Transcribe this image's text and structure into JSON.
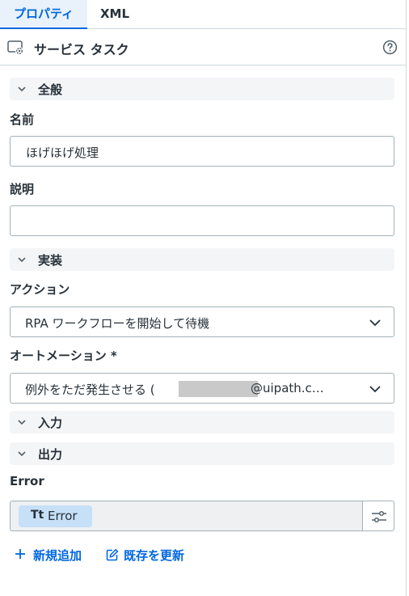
{
  "tabs": [
    {
      "label": "プロパティ",
      "active": true
    },
    {
      "label": "XML",
      "active": false
    }
  ],
  "header": {
    "task_icon": "service-task-icon",
    "title": "サービス タスク",
    "help_icon": "help-circle-icon"
  },
  "sections": {
    "general": "全般",
    "implementation": "実装",
    "input": "入力",
    "output": "出力"
  },
  "fields": {
    "name_label": "名前",
    "name_value": "ほげほげ処理",
    "description_label": "説明",
    "description_value": "",
    "action_label": "アクション",
    "action_value": "RPA ワークフローを開始して待機",
    "automation_label": "オートメーション *",
    "automation_value_prefix": "例外をただ発生させる (",
    "automation_value_suffix": "@uipath.c…",
    "error_label": "Error",
    "error_chip_type": "Tt",
    "error_chip_text": "Error"
  },
  "actions": {
    "add_new": "新規追加",
    "update_existing": "既存を更新"
  },
  "colors": {
    "accent": "#0067df",
    "chip_bg": "#c6e0f7",
    "section_bg": "#f4f5f7"
  }
}
